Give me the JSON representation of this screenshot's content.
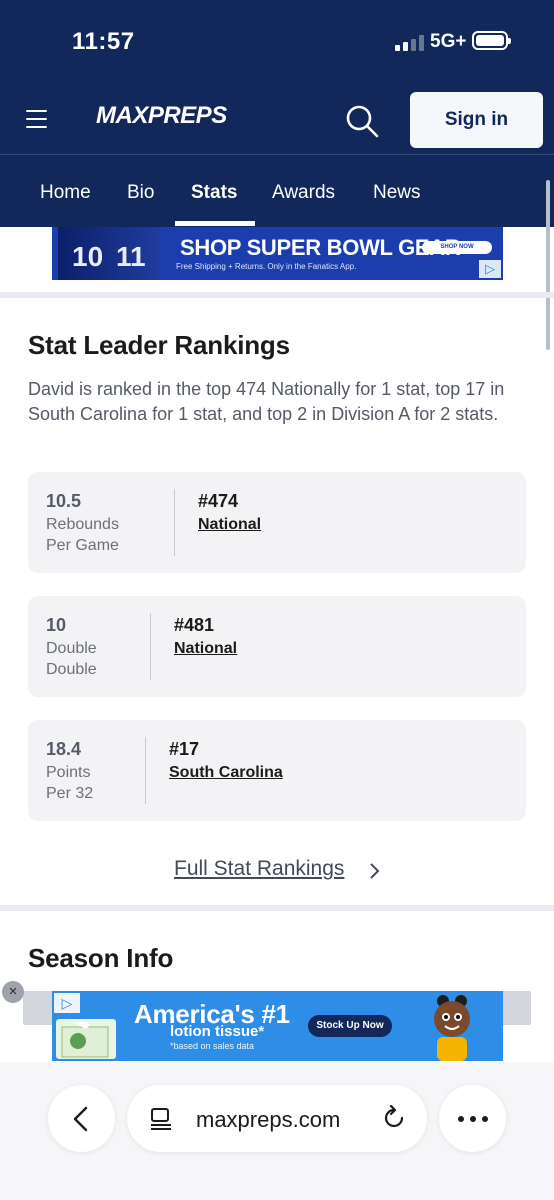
{
  "status_bar": {
    "time": "11:57",
    "network": "5G+"
  },
  "header": {
    "logo": "MAXPREPS",
    "sign_in": "Sign in"
  },
  "tabs": [
    "Home",
    "Bio",
    "Stats",
    "Awards",
    "News"
  ],
  "active_tab": "Stats",
  "ad_top": {
    "headline": "SHOP SUPER BOWL GEAR",
    "subtext": "Free Shipping + Returns. Only in the Fanatics App.",
    "jersey_numbers": [
      "10",
      "11"
    ],
    "button": "SHOP NOW"
  },
  "stat_leader": {
    "title": "Stat Leader Rankings",
    "description": "David is ranked in the top 474 Nationally for 1 stat, top 17 in South Carolina for 1 stat, and top 2 in Division A for 2 stats.",
    "cards": [
      {
        "value": "10.5",
        "label_line1": "Rebounds",
        "label_line2": "Per Game",
        "rank": "#474",
        "scope": "National"
      },
      {
        "value": "10",
        "label_line1": "Double",
        "label_line2": "Double",
        "rank": "#481",
        "scope": "National"
      },
      {
        "value": "18.4",
        "label_line1": "Points",
        "label_line2": "Per 32",
        "rank": "#17",
        "scope": "South Carolina"
      }
    ],
    "full_rankings_link": "Full Stat Rankings"
  },
  "season_info": {
    "title": "Season Info"
  },
  "ad_bottom": {
    "headline": "America's #1",
    "line2": "lotion tissue*",
    "footnote": "*based on sales data",
    "button": "Stock Up Now"
  },
  "browser": {
    "url": "maxpreps.com"
  }
}
